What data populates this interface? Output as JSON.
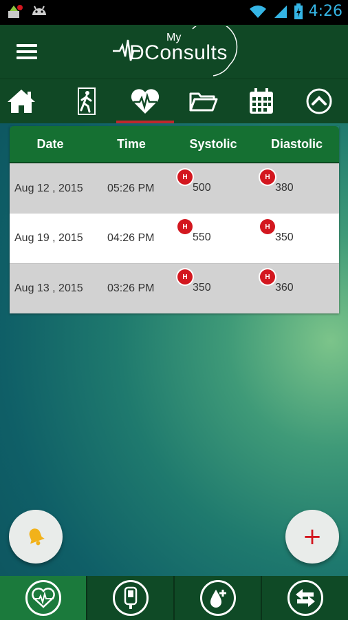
{
  "status_bar": {
    "time": "4:26"
  },
  "app": {
    "logo_small": "My",
    "logo_main": "DConsults"
  },
  "nav": [
    {
      "icon": "home-icon"
    },
    {
      "icon": "walking-man-icon"
    },
    {
      "icon": "heart-pulse-icon",
      "active": true
    },
    {
      "icon": "folder-icon"
    },
    {
      "icon": "calendar-icon"
    },
    {
      "icon": "chevron-up-circle-icon"
    }
  ],
  "table": {
    "headers": {
      "date": "Date",
      "time": "Time",
      "systolic": "Systolic",
      "diastolic": "Diastolic"
    },
    "badge_label": "H",
    "rows": [
      {
        "date": "Aug 12 , 2015",
        "time": "05:26 PM",
        "systolic": "500",
        "diastolic": "380"
      },
      {
        "date": "Aug 19 , 2015",
        "time": "04:26 PM",
        "systolic": "550",
        "diastolic": "350"
      },
      {
        "date": "Aug 13 , 2015",
        "time": "03:26 PM",
        "systolic": "350",
        "diastolic": "360"
      }
    ]
  },
  "fab": {
    "add_label": "+"
  },
  "colors": {
    "header": "#104825",
    "accent_red": "#d3171f",
    "table_header": "#157032"
  }
}
